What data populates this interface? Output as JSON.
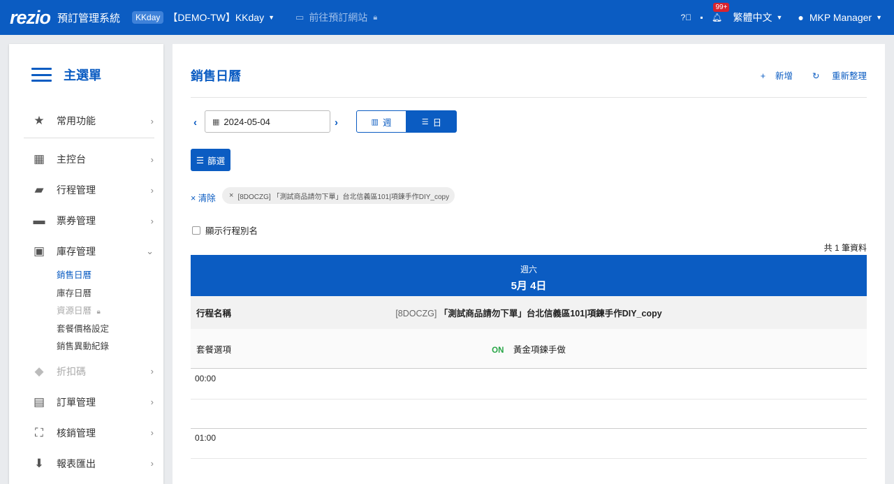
{
  "topbar": {
    "logo": "rezio",
    "system_title": "預訂管理系統",
    "tag": "KKday",
    "store": "【DEMO-TW】KKday",
    "goto_site": "前往預訂網站",
    "notification_count": "99+",
    "language": "繁體中文",
    "user": "MKP Manager"
  },
  "sidebar": {
    "title": "主選單",
    "items": [
      {
        "label": "常用功能"
      },
      {
        "label": "主控台"
      },
      {
        "label": "行程管理"
      },
      {
        "label": "票券管理"
      },
      {
        "label": "庫存管理"
      },
      {
        "label": "折扣碼"
      },
      {
        "label": "訂單管理"
      },
      {
        "label": "核銷管理"
      },
      {
        "label": "報表匯出"
      }
    ],
    "subitems": [
      "銷售日曆",
      "庫存日曆",
      "資源日曆",
      "套餐價格設定",
      "銷售異動紀錄"
    ]
  },
  "main": {
    "title": "銷售日曆",
    "add": "新增",
    "refresh": "重新整理",
    "date": "2024-05-04",
    "view_week": "週",
    "view_day": "日",
    "filter": "篩選",
    "clear": "清除",
    "chip": "[8DOCZG] 「測試商品請勿下單」台北信義區101|項鍊手作DIY_copy",
    "show_alias": "顯示行程別名",
    "total": "共 1 筆資料",
    "calendar": {
      "weekday": "週六",
      "date": "5月 4日",
      "row_product_label": "行程名稱",
      "product_code": "[8DOCZG]",
      "product_name": "「測試商品請勿下單」台北信義區101|項鍊手作DIY_copy",
      "row_package_label": "套餐選項",
      "package_status": "ON",
      "package_name": "黃金項鍊手做",
      "times": [
        "00:00",
        "01:00"
      ]
    }
  }
}
